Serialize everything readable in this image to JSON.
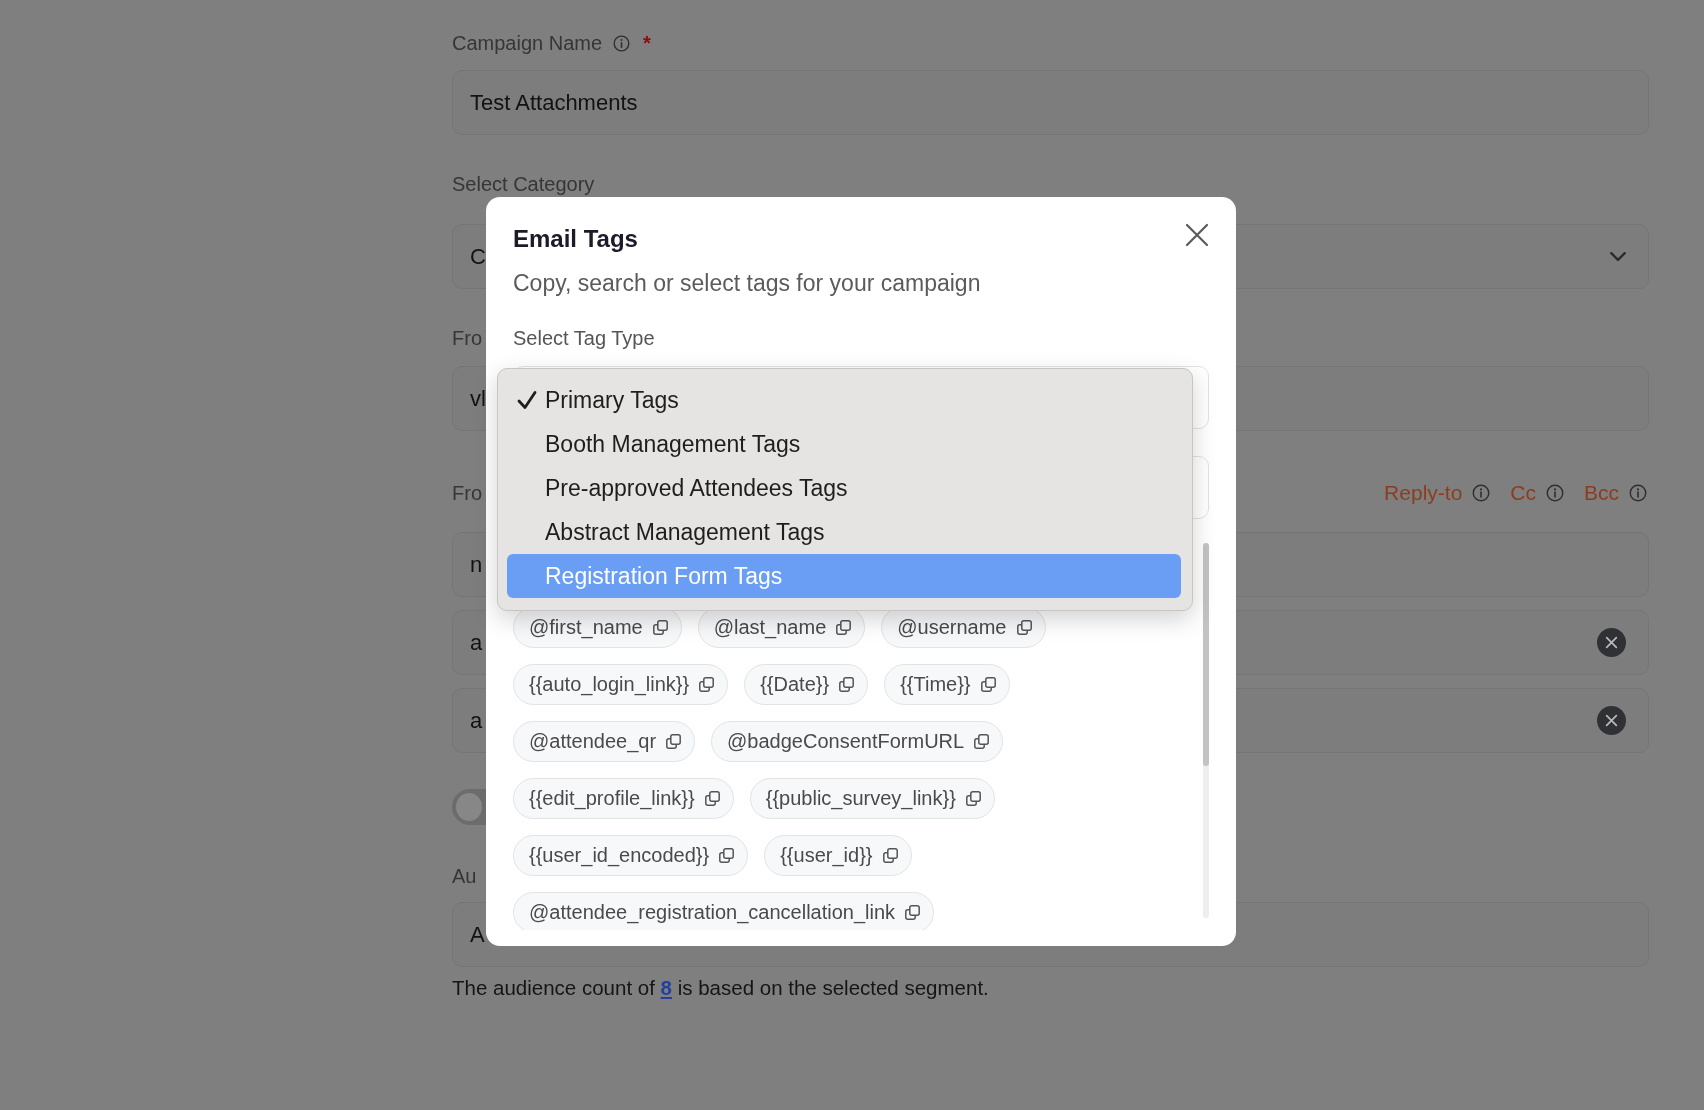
{
  "form": {
    "campaign_name": {
      "label": "Campaign Name",
      "required_mark": "*",
      "value": "Test Attachments"
    },
    "category": {
      "label": "Select Category",
      "value": "C"
    },
    "from_name": {
      "label": "Fro",
      "value": "vl"
    },
    "from_email": {
      "label": "Fro",
      "value": "n",
      "options": [
        "Reply-to",
        "Cc",
        "Bcc"
      ]
    },
    "recipients": [
      {
        "value": "a"
      },
      {
        "value": "a"
      }
    ],
    "toggle": {
      "on": false
    },
    "audience": {
      "label": "Au",
      "value": "A"
    },
    "audience_note": {
      "before": "The audience count of ",
      "count": "8",
      "after": " is based on the selected segment."
    }
  },
  "modal": {
    "title": "Email Tags",
    "subtitle": "Copy, search or select tags for your campaign",
    "tag_type_label": "Select Tag Type",
    "tag_type_menu": [
      {
        "label": "Primary Tags",
        "selected": true,
        "highlighted": false
      },
      {
        "label": "Booth Management Tags",
        "selected": false,
        "highlighted": false
      },
      {
        "label": "Pre-approved Attendees Tags",
        "selected": false,
        "highlighted": false
      },
      {
        "label": "Abstract Management Tags",
        "selected": false,
        "highlighted": false
      },
      {
        "label": "Registration Form Tags",
        "selected": false,
        "highlighted": true
      }
    ],
    "tag_rows": [
      [
        "@first_name",
        "@last_name",
        "@username"
      ],
      [
        "{{auto_login_link}}",
        "{{Date}}",
        "{{Time}}"
      ],
      [
        "@attendee_qr",
        "@badgeConsentFormURL"
      ],
      [
        "{{edit_profile_link}}",
        "{{public_survey_link}}"
      ],
      [
        "{{user_id_encoded}}",
        "{{user_id}}"
      ],
      [
        "@attendee_registration_cancellation_link"
      ]
    ]
  }
}
